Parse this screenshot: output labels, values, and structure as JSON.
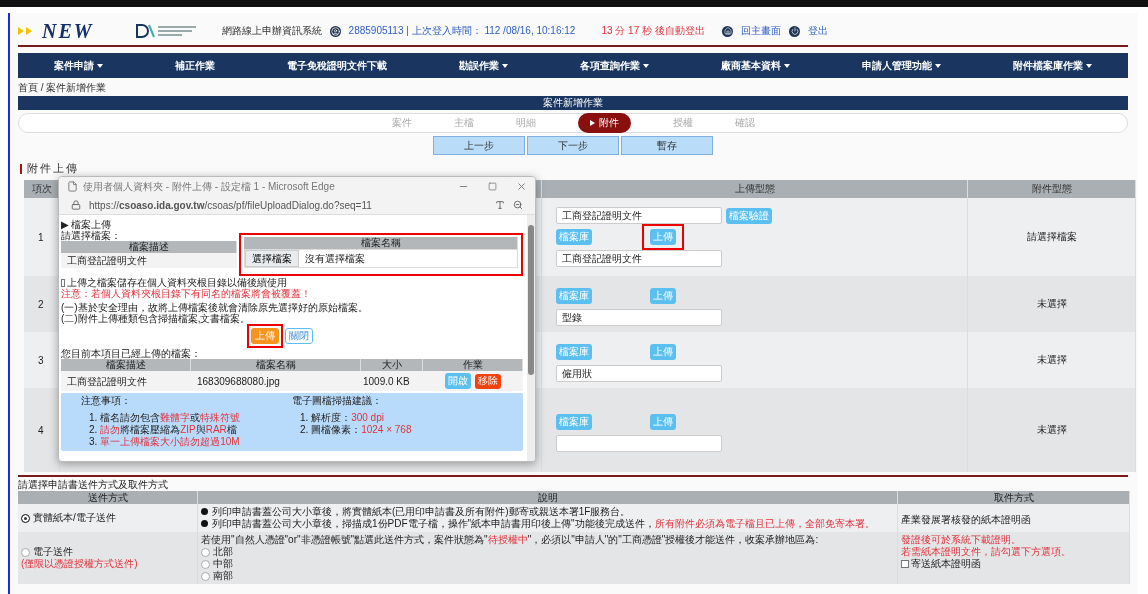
{
  "header": {
    "brand": "NEW",
    "system_title": "網路線上申辦資訊系統",
    "user": "2885905113 | 上次登入時間： 112 /08/16, 10:16:12",
    "timer": "13 分 17 秒 後自動登出",
    "home_link": "回主畫面",
    "logout_link": "登出"
  },
  "nav": [
    {
      "label": "案件申請",
      "dropdown": true
    },
    {
      "label": "補正作業",
      "dropdown": false
    },
    {
      "label": "電子免稅證明文件下載",
      "dropdown": false
    },
    {
      "label": "勘誤作業",
      "dropdown": true
    },
    {
      "label": "各項查詢作業",
      "dropdown": true
    },
    {
      "label": "廠商基本資料",
      "dropdown": true
    },
    {
      "label": "申請人管理功能",
      "dropdown": true
    },
    {
      "label": "附件檔案庫作業",
      "dropdown": true
    }
  ],
  "breadcrumb": "首頁 / 案件新增作業",
  "page_title": "案件新增作業",
  "steps": [
    {
      "label": "案件",
      "selected": false
    },
    {
      "label": "主檔",
      "selected": false
    },
    {
      "label": "明細",
      "selected": false
    },
    {
      "label": "附件",
      "selected": true
    },
    {
      "label": "授權",
      "selected": false
    },
    {
      "label": "確認",
      "selected": false
    }
  ],
  "step_buttons": [
    "上一步",
    "下一步",
    "暫存"
  ],
  "section_title": "附件上傳",
  "attachment_table": {
    "columns": [
      "項次",
      "上傳型態",
      "附件型態"
    ],
    "rows": [
      {
        "number": "1",
        "verify_field": "工商登記證明文件",
        "verify_button": "檔案驗證",
        "library_button": "檔案庫",
        "upload_button": "上傳",
        "upload_highlighted": true,
        "file_field": "工商登記證明文件",
        "status": "請選擇檔案"
      },
      {
        "number": "2",
        "library_button": "檔案庫",
        "upload_button": "上傳",
        "upload_highlighted": false,
        "file_field": "型錄",
        "status": "未選擇"
      },
      {
        "number": "3",
        "library_button": "檔案庫",
        "upload_button": "上傳",
        "upload_highlighted": false,
        "file_field": "僱用狀",
        "status": "未選擇"
      },
      {
        "number": "4",
        "library_button": "檔案庫",
        "upload_button": "上傳",
        "upload_highlighted": false,
        "status": "未選擇"
      }
    ]
  },
  "popup": {
    "title": "使用者個人資料夾 - 附件上傳 - 設定檔 1 - Microsoft Edge",
    "url": "https://**csoaso.ida.gov.tw**/csoas/pf/fileUploadDialog.do?seq=11",
    "marker": "▶",
    "heading": "檔案上傳",
    "prompt": "請選擇檔案：",
    "select_columns": [
      "檔案描述",
      "檔案名稱"
    ],
    "select_highlighted": true,
    "file_description": "工商登記證明文件",
    "choose_button": "選擇檔案",
    "chosen_file": "沒有選擇檔案",
    "save_checkbox": {
      "label": "上傳之檔案儲存在個人資料夾根目錄以備後續使用",
      "checked": false
    },
    "warning": "注意：若個人資料夾根目錄下有同名的檔案將會被覆蓋！",
    "notes": [
      "(一)基於安全理由，故將上傳檔案後就會清除原先選擇好的原始檔案。",
      "(二)附件上傳種類包含掃描檔案,文書檔案。"
    ],
    "upload_button": "上傳",
    "upload_highlighted": true,
    "close_button": "關閉",
    "uploaded_title": "您目前本項目已經上傳的檔案：",
    "uploaded_columns": [
      "檔案描述",
      "檔案名稱",
      "大小",
      "作業"
    ],
    "uploaded_rows": [
      {
        "description": "工商登記證明文件",
        "file_name": "168309688080.jpg",
        "size": "1009.0 KB",
        "open_button": "開啟",
        "remove_button": "移除"
      }
    ],
    "tips": [
      {
        "title": "注意事項：",
        "items": [
          {
            "number": "1.",
            "parts": [
              {
                "text": "檔名請勿包含",
                "alert": false
              },
              {
                "text": "難體字",
                "alert": true
              },
              {
                "text": "或",
                "alert": false
              },
              {
                "text": "特殊符號",
                "alert": true
              }
            ]
          },
          {
            "number": "2.",
            "parts": [
              {
                "text": "請勿",
                "alert": true
              },
              {
                "text": "將檔案壓縮為",
                "alert": false
              },
              {
                "text": "ZIP",
                "alert": true
              },
              {
                "text": "與",
                "alert": false
              },
              {
                "text": "RAR",
                "alert": true
              },
              {
                "text": "檔",
                "alert": false
              }
            ]
          },
          {
            "number": "3.",
            "parts": [
              {
                "text": "單一上傳檔案大小請勿超過10M",
                "alert": true
              }
            ]
          }
        ]
      },
      {
        "title": "電子圖檔掃描建議：",
        "items": [
          {
            "number": "1.",
            "parts": [
              {
                "text": "解析度：",
                "alert": false
              },
              {
                "text": "300 dpi",
                "alert": true
              }
            ]
          },
          {
            "number": "2.",
            "parts": [
              {
                "text": "圖檔像素：",
                "alert": false
              },
              {
                "text": "1024 × 768",
                "alert": true
              }
            ]
          }
        ]
      }
    ]
  },
  "delivery": {
    "title": "請選擇申請書送件方式及取件方式",
    "columns": [
      "送件方式",
      "說明",
      "取件方式"
    ],
    "rows": [
      {
        "method": "實體紙本/電子送件",
        "selected": true,
        "bullets": [
          [
            {
              "text": "列印申請書蓋公司大小章後，將實體紙本(已用印申請書及所有附件)郵寄或親送本署1F服務台。",
              "alert": false
            }
          ],
          [
            {
              "text": "列印申請書蓋公司大小章後，掃描成1份PDF電子檔，操作\"紙本申請書用印後上傳\"功能後完成送件，",
              "alert": false
            },
            {
              "text": "所有附件必須為電子檔且已上傳，全部免寄本署。",
              "alert": true
            }
          ]
        ],
        "pickup": [
          {
            "kind": "text",
            "text": "產業發展署核發的紙本證明函"
          }
        ]
      },
      {
        "method": "電子送件",
        "method_note": "(僅限以憑證授權方式送件)",
        "selected": false,
        "description": [
          {
            "text": "若使用\"自然人憑證\"or\"非憑證帳號\"點選此送件方式，案件狀態為\"",
            "alert": false
          },
          {
            "text": "待授權中",
            "alert": true
          },
          {
            "text": "\"，必須以\"申請人\"的\"工商憑證\"授權後才能送件，收案承辦地區為:",
            "alert": false
          }
        ],
        "regions": [
          {
            "label": "北部",
            "selected": false
          },
          {
            "label": "中部",
            "selected": false
          },
          {
            "label": "南部",
            "selected": false
          }
        ],
        "pickup": [
          {
            "kind": "alert",
            "text": "發證後可於系統下載證明。"
          },
          {
            "kind": "alert",
            "text": "若需紙本證明文件，請勾選下方選項。"
          },
          {
            "kind": "checkbox",
            "text": "寄送紙本證明函",
            "checked": false
          }
        ]
      }
    ]
  }
}
